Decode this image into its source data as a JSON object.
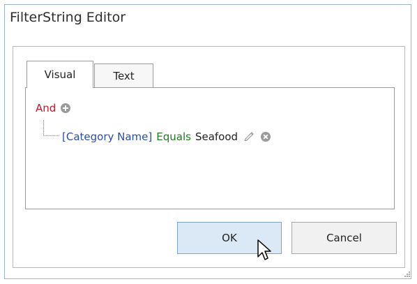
{
  "dialog": {
    "title": "FilterString Editor"
  },
  "tabs": [
    {
      "label": "Visual",
      "active": true
    },
    {
      "label": "Text",
      "active": false
    }
  ],
  "filter": {
    "group_operator": "And",
    "condition": {
      "field": "[Category Name]",
      "operator": "Equals",
      "value": "Seafood"
    }
  },
  "buttons": {
    "ok": "OK",
    "cancel": "Cancel"
  },
  "icons": {
    "add_condition": "plus-circle-icon",
    "edit": "pencil-icon",
    "remove": "x-circle-icon"
  },
  "colors": {
    "and": "#c0162a",
    "field": "#2b4ea8",
    "operator": "#1f7a1f",
    "ok_button_bg": "#dbe8f5"
  }
}
